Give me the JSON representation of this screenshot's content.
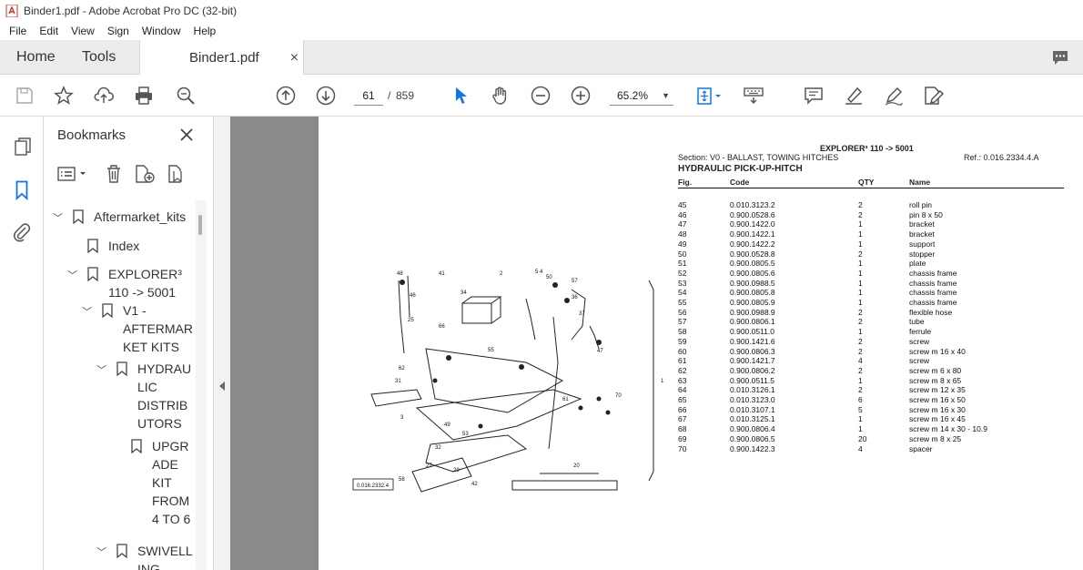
{
  "window": {
    "title": "Binder1.pdf - Adobe Acrobat Pro DC (32-bit)"
  },
  "menu": [
    "File",
    "Edit",
    "View",
    "Sign",
    "Window",
    "Help"
  ],
  "tabs": {
    "home": "Home",
    "tools": "Tools",
    "document": "Binder1.pdf",
    "close_glyph": "×"
  },
  "toolbar": {
    "current_page": "61",
    "separator": "/",
    "total_pages": "859",
    "zoom": "65.2%"
  },
  "bookmarks": {
    "title": "Bookmarks",
    "items": [
      {
        "label": "Aftermarket_kits"
      },
      {
        "label": "Index"
      },
      {
        "label": "EXPLORER³ 110 -> 5001",
        "lines": [
          "EXPLORER³",
          "110 -> 5001"
        ]
      },
      {
        "label": "V1 - AFTERMARKET KITS",
        "lines": [
          "V1 -",
          "AFTERMAR",
          "KET KITS"
        ]
      },
      {
        "label": "HYDRAULIC DISTRIBUTORS",
        "lines": [
          "HYDRAU",
          "LIC",
          "DISTRIB",
          "UTORS"
        ]
      },
      {
        "label": "UPGRADE KIT FROM 4 TO 6",
        "lines": [
          "UPGR",
          "ADE",
          "KIT",
          "FROM",
          "4 TO 6"
        ]
      },
      {
        "label": "SWIVELLING",
        "lines": [
          "SWIVELL",
          "ING"
        ]
      }
    ]
  },
  "document": {
    "header": "EXPLORER³ 110 -> 5001",
    "section": "Section: V0 - BALLAST, TOWING HITCHES",
    "ref": "Ref.: 0.016.2334.4.A",
    "subtitle": "HYDRAULIC PICK-UP-HITCH",
    "columns": [
      "Fig.",
      "Code",
      "QTY",
      "Name"
    ],
    "drawing_ref": "0.016.2332.4",
    "rows": [
      [
        "45",
        "0.010.3123.2",
        "2",
        "roll pin"
      ],
      [
        "46",
        "0.900.0528.6",
        "2",
        "pin 8 x 50"
      ],
      [
        "47",
        "0.900.1422.0",
        "1",
        "bracket"
      ],
      [
        "48",
        "0.900.1422.1",
        "1",
        "bracket"
      ],
      [
        "49",
        "0.900.1422.2",
        "1",
        "support"
      ],
      [
        "50",
        "0.900.0528.8",
        "2",
        "stopper"
      ],
      [
        "51",
        "0.900.0805.5",
        "1",
        "plate"
      ],
      [
        "52",
        "0.900.0805.6",
        "1",
        "chassis frame"
      ],
      [
        "53",
        "0.900.0988.5",
        "1",
        "chassis frame"
      ],
      [
        "54",
        "0.900.0805.8",
        "1",
        "chassis frame"
      ],
      [
        "55",
        "0.900.0805.9",
        "1",
        "chassis frame"
      ],
      [
        "56",
        "0.900.0988.9",
        "2",
        "flexible hose"
      ],
      [
        "57",
        "0.900.0806.1",
        "2",
        "tube"
      ],
      [
        "58",
        "0.900.0511.0",
        "1",
        "ferrule"
      ],
      [
        "59",
        "0.900.1421.6",
        "2",
        "screw"
      ],
      [
        "60",
        "0.900.0806.3",
        "2",
        "screw m 16 x 40"
      ],
      [
        "61",
        "0.900.1421.7",
        "4",
        "screw"
      ],
      [
        "62",
        "0.900.0806.2",
        "2",
        "screw m 6 x 80"
      ],
      [
        "63",
        "0.900.0511.5",
        "1",
        "screw m 8 x 65"
      ],
      [
        "64",
        "0.010.3126.1",
        "2",
        "screw m 12 x 35"
      ],
      [
        "65",
        "0.010.3123.0",
        "6",
        "screw m 16 x 50"
      ],
      [
        "66",
        "0.010.3107.1",
        "5",
        "screw m 16 x 30"
      ],
      [
        "67",
        "0.010.3125.1",
        "1",
        "screw m 16 x 45"
      ],
      [
        "68",
        "0.900.0806.4",
        "1",
        "screw m 14 x 30 - 10.9"
      ],
      [
        "69",
        "0.900.0806.5",
        "20",
        "screw m 8 x 25"
      ],
      [
        "70",
        "0.900.1422.3",
        "4",
        "spacer"
      ]
    ]
  }
}
